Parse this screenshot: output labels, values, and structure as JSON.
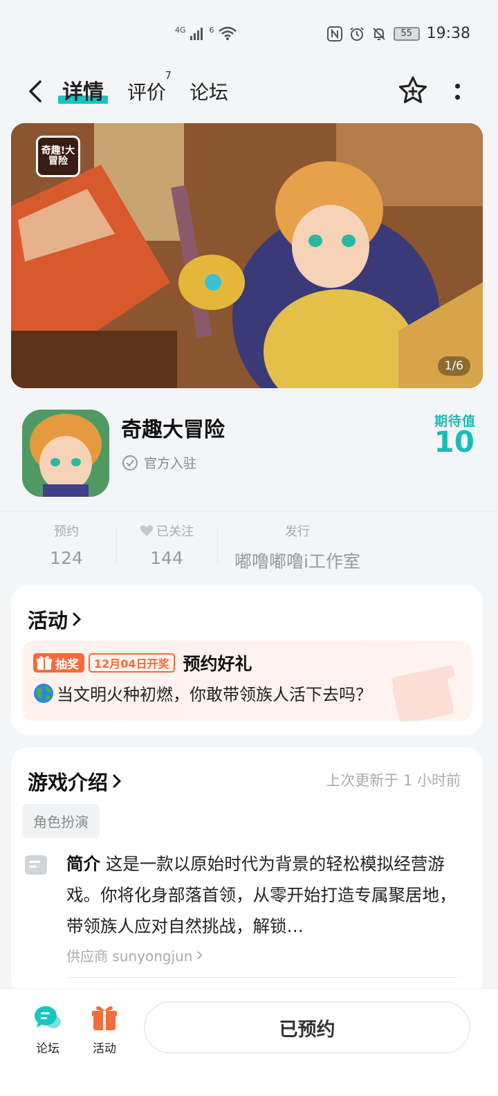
{
  "status_bar": {
    "network": "4G",
    "wifi_label": "6",
    "battery": "55",
    "time": "19:38"
  },
  "nav": {
    "tabs": [
      {
        "label": "详情",
        "active": true
      },
      {
        "label": "评价",
        "badge": "7"
      },
      {
        "label": "论坛"
      }
    ]
  },
  "banner": {
    "logo_text": "奇趣!大冒险",
    "counter": "1/6"
  },
  "app": {
    "title": "奇趣大冒险",
    "official_label": "官方入驻",
    "expect_label": "期待值",
    "expect_value": "10"
  },
  "stats": {
    "reserve_label": "预约",
    "reserve_value": "124",
    "follow_label": "已关注",
    "follow_value": "144",
    "publisher_label": "发行",
    "publisher_value": "嘟噜嘟噜i工作室"
  },
  "activity": {
    "title": "活动",
    "lottery_tag": "抽奖",
    "date_tag": "12月04日开奖",
    "event_name": "预约好礼",
    "event_desc": "当文明火种初燃，你敢带领族人活下去吗？"
  },
  "intro": {
    "title": "游戏介绍",
    "update_time": "上次更新于 1 小时前",
    "genre": "角色扮演",
    "intro_label": "简介",
    "intro_text": " 这是一款以原始时代为背景的轻松模拟经营游戏。你将化身部落首领，从零开始打造专属聚居地，带领族人应对自然挑战，解锁…",
    "provider": "供应商 sunyongjun"
  },
  "bottom": {
    "forum_label": "论坛",
    "activity_label": "活动",
    "reserved_label": "已预约"
  },
  "colors": {
    "accent": "#16c6c0",
    "orange": "#f46b3c"
  }
}
